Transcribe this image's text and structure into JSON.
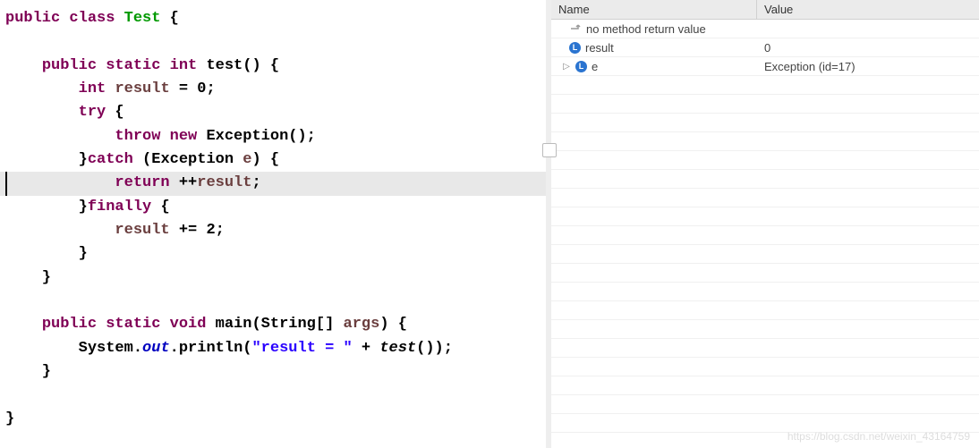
{
  "code": {
    "lines": [
      {
        "raw": "public class Test {",
        "tokens": [
          {
            "t": "public",
            "c": "kw-purple"
          },
          {
            "t": " class ",
            "c": "kw-purple"
          },
          {
            "t": "Test",
            "c": "kw-green"
          },
          {
            "t": " {",
            "c": "punct"
          }
        ]
      },
      {
        "raw": ""
      },
      {
        "raw": "    public static int test() {",
        "tokens": [
          {
            "t": "    ",
            "c": ""
          },
          {
            "t": "public static int ",
            "c": "kw-purple"
          },
          {
            "t": "test",
            "c": "type"
          },
          {
            "t": "() {",
            "c": "punct"
          }
        ]
      },
      {
        "raw": "        int result = 0;",
        "tokens": [
          {
            "t": "        ",
            "c": ""
          },
          {
            "t": "int ",
            "c": "kw-purple"
          },
          {
            "t": "result",
            "c": "ident"
          },
          {
            "t": " = ",
            "c": "punct"
          },
          {
            "t": "0",
            "c": "num"
          },
          {
            "t": ";",
            "c": "punct"
          }
        ]
      },
      {
        "raw": "        try {",
        "tokens": [
          {
            "t": "        ",
            "c": ""
          },
          {
            "t": "try",
            "c": "kw-purple"
          },
          {
            "t": " {",
            "c": "punct"
          }
        ]
      },
      {
        "raw": "            throw new Exception();",
        "tokens": [
          {
            "t": "            ",
            "c": ""
          },
          {
            "t": "throw new ",
            "c": "kw-purple"
          },
          {
            "t": "Exception",
            "c": "type"
          },
          {
            "t": "();",
            "c": "punct"
          }
        ]
      },
      {
        "raw": "        }catch (Exception e) {",
        "tokens": [
          {
            "t": "        }",
            "c": "punct"
          },
          {
            "t": "catch",
            "c": "kw-purple"
          },
          {
            "t": " (",
            "c": "punct"
          },
          {
            "t": "Exception",
            "c": "type"
          },
          {
            "t": " ",
            "c": ""
          },
          {
            "t": "e",
            "c": "ident"
          },
          {
            "t": ") {",
            "c": "punct"
          }
        ]
      },
      {
        "raw": "            return ++result;",
        "current": true,
        "tokens": [
          {
            "t": "            ",
            "c": ""
          },
          {
            "t": "return",
            "c": "kw-purple"
          },
          {
            "t": " ++",
            "c": "punct"
          },
          {
            "t": "result",
            "c": "ident"
          },
          {
            "t": ";",
            "c": "punct"
          }
        ]
      },
      {
        "raw": "        }finally {",
        "tokens": [
          {
            "t": "        }",
            "c": "punct"
          },
          {
            "t": "finally",
            "c": "kw-purple"
          },
          {
            "t": " {",
            "c": "punct"
          }
        ]
      },
      {
        "raw": "            result += 2;",
        "tokens": [
          {
            "t": "            ",
            "c": ""
          },
          {
            "t": "result",
            "c": "ident"
          },
          {
            "t": " += ",
            "c": "punct"
          },
          {
            "t": "2",
            "c": "num"
          },
          {
            "t": ";",
            "c": "punct"
          }
        ]
      },
      {
        "raw": "        }",
        "tokens": [
          {
            "t": "        }",
            "c": "punct"
          }
        ]
      },
      {
        "raw": "    }",
        "tokens": [
          {
            "t": "    }",
            "c": "punct"
          }
        ]
      },
      {
        "raw": ""
      },
      {
        "raw": "    public static void main(String[] args) {",
        "tokens": [
          {
            "t": "    ",
            "c": ""
          },
          {
            "t": "public static void ",
            "c": "kw-purple"
          },
          {
            "t": "main",
            "c": "type"
          },
          {
            "t": "(",
            "c": "punct"
          },
          {
            "t": "String",
            "c": "type"
          },
          {
            "t": "[] ",
            "c": "punct"
          },
          {
            "t": "args",
            "c": "ident"
          },
          {
            "t": ") {",
            "c": "punct"
          }
        ]
      },
      {
        "raw": "        System.out.println(\"result = \" + test());",
        "tokens": [
          {
            "t": "        ",
            "c": ""
          },
          {
            "t": "System",
            "c": "type"
          },
          {
            "t": ".",
            "c": "punct"
          },
          {
            "t": "out",
            "c": "static-field"
          },
          {
            "t": ".",
            "c": "punct"
          },
          {
            "t": "println",
            "c": "type"
          },
          {
            "t": "(",
            "c": "punct"
          },
          {
            "t": "\"result = \"",
            "c": "str"
          },
          {
            "t": " + ",
            "c": "punct"
          },
          {
            "t": "test",
            "c": "call-italic"
          },
          {
            "t": "());",
            "c": "punct"
          }
        ]
      },
      {
        "raw": "    }",
        "tokens": [
          {
            "t": "    }",
            "c": "punct"
          }
        ]
      },
      {
        "raw": ""
      },
      {
        "raw": "}",
        "tokens": [
          {
            "t": "}",
            "c": "punct"
          }
        ]
      }
    ]
  },
  "variables": {
    "columns": {
      "name": "Name",
      "value": "Value"
    },
    "rows": [
      {
        "icon": "return",
        "name": "no method return value",
        "value": "",
        "expandable": false,
        "indent": 1
      },
      {
        "icon": "local",
        "name": "result",
        "value": "0",
        "expandable": false,
        "indent": 1
      },
      {
        "icon": "local",
        "name": "e",
        "value": "Exception  (id=17)",
        "expandable": true,
        "indent": 0
      }
    ],
    "emptyRows": 20
  },
  "watermark": "https://blog.csdn.net/weixin_43164759"
}
